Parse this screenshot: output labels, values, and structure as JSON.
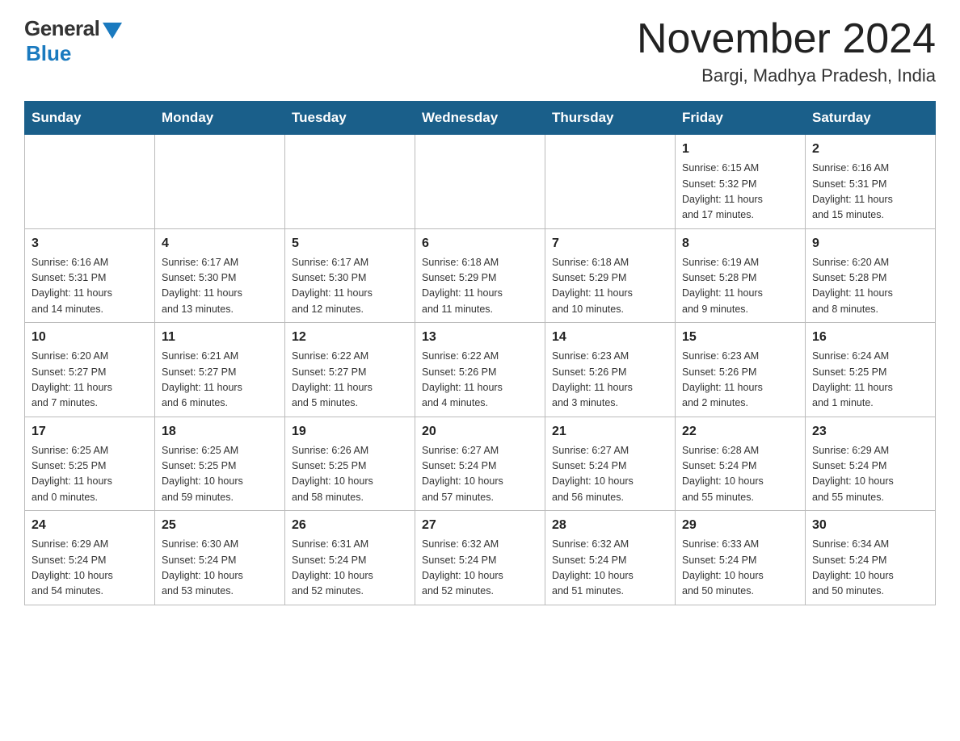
{
  "header": {
    "logo_general": "General",
    "logo_blue": "Blue",
    "title": "November 2024",
    "subtitle": "Bargi, Madhya Pradesh, India"
  },
  "days_of_week": [
    "Sunday",
    "Monday",
    "Tuesday",
    "Wednesday",
    "Thursday",
    "Friday",
    "Saturday"
  ],
  "weeks": [
    [
      {
        "day": "",
        "info": ""
      },
      {
        "day": "",
        "info": ""
      },
      {
        "day": "",
        "info": ""
      },
      {
        "day": "",
        "info": ""
      },
      {
        "day": "",
        "info": ""
      },
      {
        "day": "1",
        "info": "Sunrise: 6:15 AM\nSunset: 5:32 PM\nDaylight: 11 hours\nand 17 minutes."
      },
      {
        "day": "2",
        "info": "Sunrise: 6:16 AM\nSunset: 5:31 PM\nDaylight: 11 hours\nand 15 minutes."
      }
    ],
    [
      {
        "day": "3",
        "info": "Sunrise: 6:16 AM\nSunset: 5:31 PM\nDaylight: 11 hours\nand 14 minutes."
      },
      {
        "day": "4",
        "info": "Sunrise: 6:17 AM\nSunset: 5:30 PM\nDaylight: 11 hours\nand 13 minutes."
      },
      {
        "day": "5",
        "info": "Sunrise: 6:17 AM\nSunset: 5:30 PM\nDaylight: 11 hours\nand 12 minutes."
      },
      {
        "day": "6",
        "info": "Sunrise: 6:18 AM\nSunset: 5:29 PM\nDaylight: 11 hours\nand 11 minutes."
      },
      {
        "day": "7",
        "info": "Sunrise: 6:18 AM\nSunset: 5:29 PM\nDaylight: 11 hours\nand 10 minutes."
      },
      {
        "day": "8",
        "info": "Sunrise: 6:19 AM\nSunset: 5:28 PM\nDaylight: 11 hours\nand 9 minutes."
      },
      {
        "day": "9",
        "info": "Sunrise: 6:20 AM\nSunset: 5:28 PM\nDaylight: 11 hours\nand 8 minutes."
      }
    ],
    [
      {
        "day": "10",
        "info": "Sunrise: 6:20 AM\nSunset: 5:27 PM\nDaylight: 11 hours\nand 7 minutes."
      },
      {
        "day": "11",
        "info": "Sunrise: 6:21 AM\nSunset: 5:27 PM\nDaylight: 11 hours\nand 6 minutes."
      },
      {
        "day": "12",
        "info": "Sunrise: 6:22 AM\nSunset: 5:27 PM\nDaylight: 11 hours\nand 5 minutes."
      },
      {
        "day": "13",
        "info": "Sunrise: 6:22 AM\nSunset: 5:26 PM\nDaylight: 11 hours\nand 4 minutes."
      },
      {
        "day": "14",
        "info": "Sunrise: 6:23 AM\nSunset: 5:26 PM\nDaylight: 11 hours\nand 3 minutes."
      },
      {
        "day": "15",
        "info": "Sunrise: 6:23 AM\nSunset: 5:26 PM\nDaylight: 11 hours\nand 2 minutes."
      },
      {
        "day": "16",
        "info": "Sunrise: 6:24 AM\nSunset: 5:25 PM\nDaylight: 11 hours\nand 1 minute."
      }
    ],
    [
      {
        "day": "17",
        "info": "Sunrise: 6:25 AM\nSunset: 5:25 PM\nDaylight: 11 hours\nand 0 minutes."
      },
      {
        "day": "18",
        "info": "Sunrise: 6:25 AM\nSunset: 5:25 PM\nDaylight: 10 hours\nand 59 minutes."
      },
      {
        "day": "19",
        "info": "Sunrise: 6:26 AM\nSunset: 5:25 PM\nDaylight: 10 hours\nand 58 minutes."
      },
      {
        "day": "20",
        "info": "Sunrise: 6:27 AM\nSunset: 5:24 PM\nDaylight: 10 hours\nand 57 minutes."
      },
      {
        "day": "21",
        "info": "Sunrise: 6:27 AM\nSunset: 5:24 PM\nDaylight: 10 hours\nand 56 minutes."
      },
      {
        "day": "22",
        "info": "Sunrise: 6:28 AM\nSunset: 5:24 PM\nDaylight: 10 hours\nand 55 minutes."
      },
      {
        "day": "23",
        "info": "Sunrise: 6:29 AM\nSunset: 5:24 PM\nDaylight: 10 hours\nand 55 minutes."
      }
    ],
    [
      {
        "day": "24",
        "info": "Sunrise: 6:29 AM\nSunset: 5:24 PM\nDaylight: 10 hours\nand 54 minutes."
      },
      {
        "day": "25",
        "info": "Sunrise: 6:30 AM\nSunset: 5:24 PM\nDaylight: 10 hours\nand 53 minutes."
      },
      {
        "day": "26",
        "info": "Sunrise: 6:31 AM\nSunset: 5:24 PM\nDaylight: 10 hours\nand 52 minutes."
      },
      {
        "day": "27",
        "info": "Sunrise: 6:32 AM\nSunset: 5:24 PM\nDaylight: 10 hours\nand 52 minutes."
      },
      {
        "day": "28",
        "info": "Sunrise: 6:32 AM\nSunset: 5:24 PM\nDaylight: 10 hours\nand 51 minutes."
      },
      {
        "day": "29",
        "info": "Sunrise: 6:33 AM\nSunset: 5:24 PM\nDaylight: 10 hours\nand 50 minutes."
      },
      {
        "day": "30",
        "info": "Sunrise: 6:34 AM\nSunset: 5:24 PM\nDaylight: 10 hours\nand 50 minutes."
      }
    ]
  ]
}
